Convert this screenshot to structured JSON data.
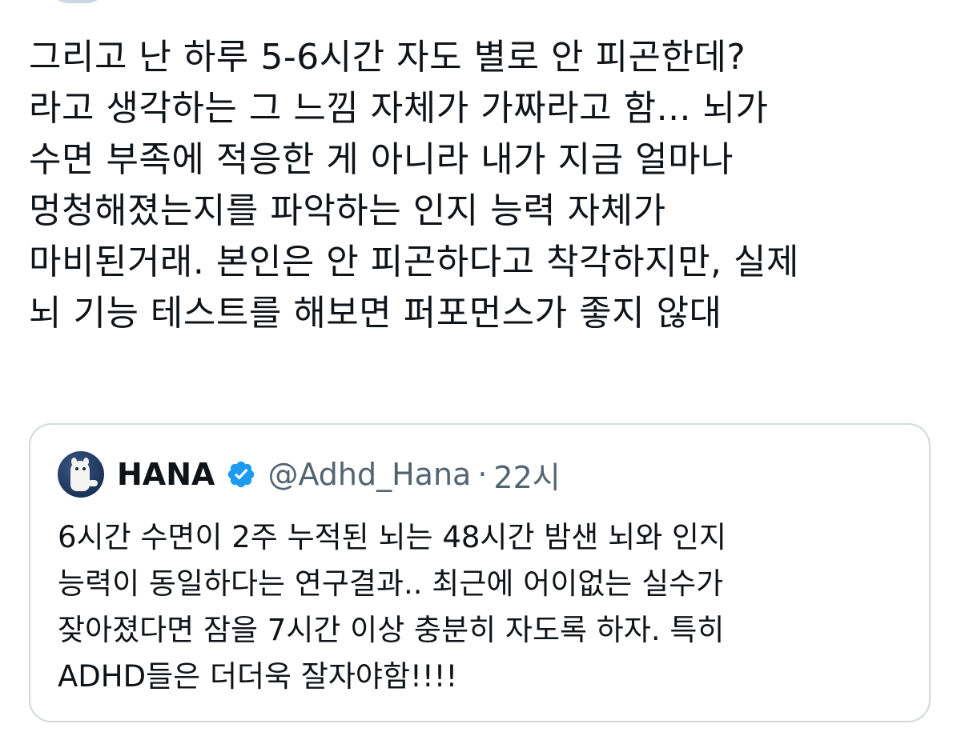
{
  "tweet": {
    "lines": [
      "그리고 난 하루 5-6시간 자도 별로 안 피곤한데?",
      "라고 생각하는 그 느낌 자체가 가짜라고 함... 뇌가",
      "수면 부족에 적응한 게 아니라 내가 지금 얼마나",
      "멍청해졌는지를 파악하는 인지 능력 자체가",
      "마비된거래. 본인은 안 피곤하다고 착각하지만, 실제",
      "뇌 기능 테스트를 해보면 퍼포먼스가 좋지 않대"
    ]
  },
  "quote": {
    "name": "HANA",
    "handle": "@Adhd_Hana",
    "separator": "·",
    "time": "22시",
    "verified_icon": "verified-badge-icon",
    "avatar_icon": "white-cat-avatar",
    "lines": [
      "6시간 수면이 2주 누적된 뇌는 48시간 밤샌 뇌와 인지",
      "능력이 동일하다는 연구결과.. 최근에 어이없는 실수가",
      "잦아졌다면 잠을 7시간 이상 충분히 자도록 하자. 특히",
      "ADHD들은 더더욱 잘자야함!!!!"
    ]
  },
  "colors": {
    "text": "#0f1419",
    "secondary_text": "#536471",
    "verified_blue": "#1d9bf0",
    "card_border": "#cfd9de"
  }
}
